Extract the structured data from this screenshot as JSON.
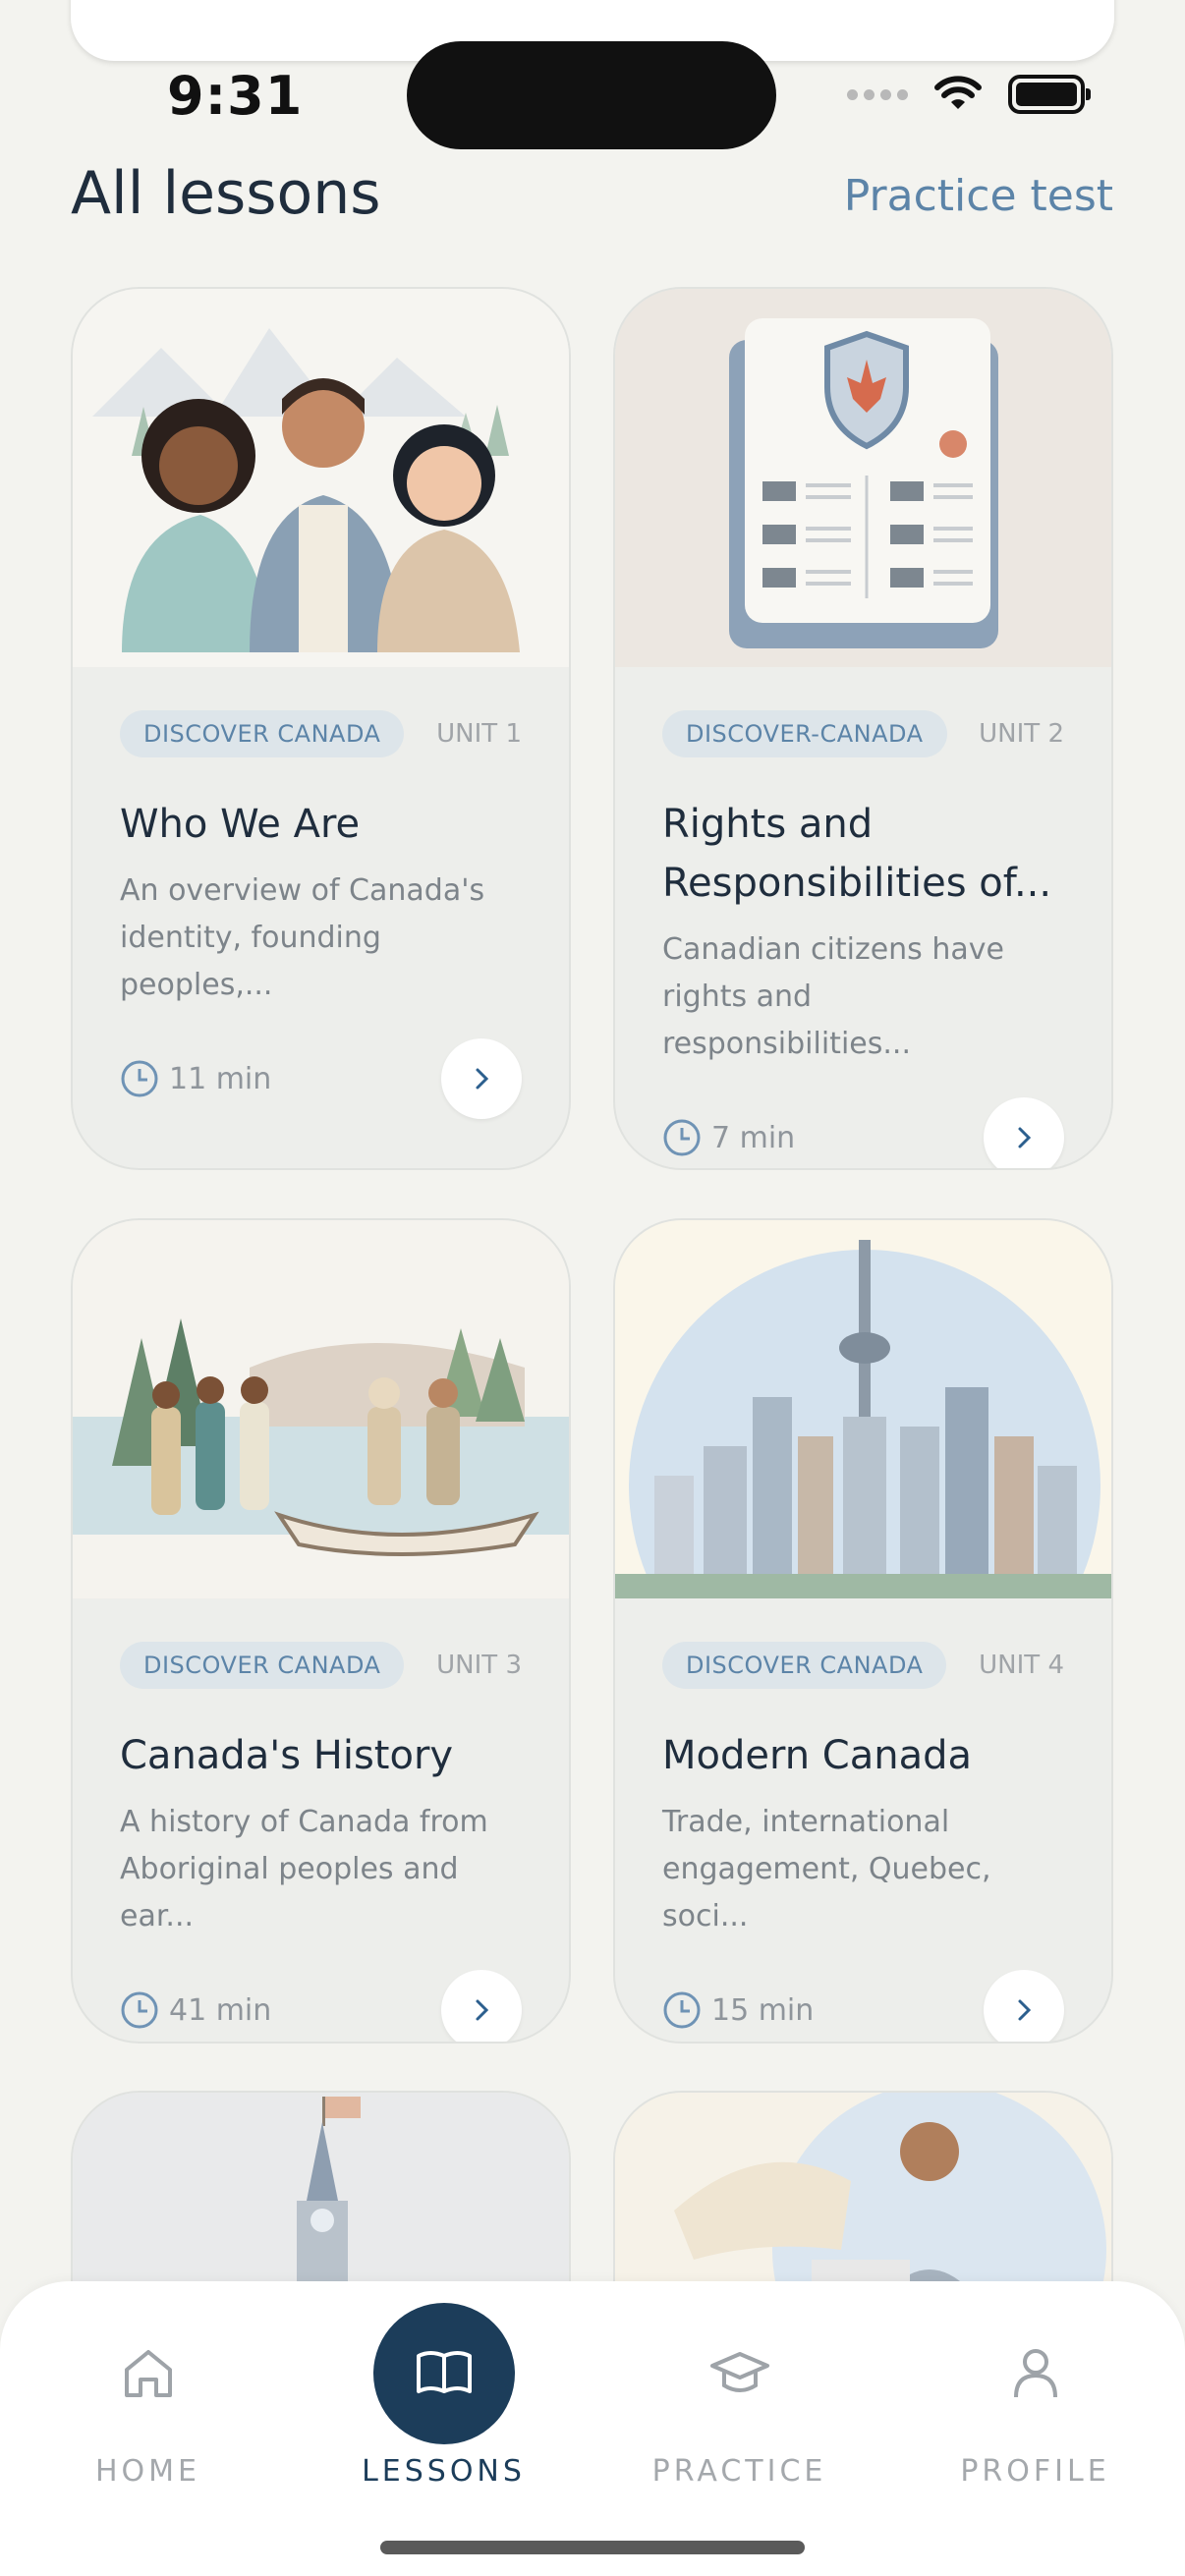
{
  "status_bar": {
    "time": "9:31"
  },
  "header": {
    "title": "All lessons",
    "practice_link": "Practice test"
  },
  "lessons": [
    {
      "tag": "DISCOVER CANADA",
      "unit": "UNIT 1",
      "title": "Who We Are",
      "description_lines": [
        "An overview of Canada's",
        "identity, founding peoples,..."
      ],
      "duration": "11 min",
      "illustration": "three-people-portrait"
    },
    {
      "tag": "DISCOVER-CANADA",
      "unit": "UNIT 2",
      "title_lines": [
        "Rights and",
        "Responsibilities of..."
      ],
      "description_lines": [
        "Canadian citizens have",
        "rights and responsibilities..."
      ],
      "duration": "7 min",
      "illustration": "charter-document-icon"
    },
    {
      "tag": "DISCOVER CANADA",
      "unit": "UNIT 3",
      "title": "Canada's History",
      "description_lines": [
        "A history of Canada from",
        "Aboriginal peoples and ear..."
      ],
      "duration": "41 min",
      "illustration": "history-scene"
    },
    {
      "tag": "DISCOVER CANADA",
      "unit": "UNIT 4",
      "title": "Modern Canada",
      "description_lines": [
        "Trade, international",
        "engagement, Quebec, soci..."
      ],
      "duration": "15 min",
      "illustration": "city-skyline"
    }
  ],
  "nav": [
    {
      "label": "HOME",
      "icon": "home-icon",
      "active": false
    },
    {
      "label": "LESSONS",
      "icon": "book-icon",
      "active": true
    },
    {
      "label": "PRACTICE",
      "icon": "graduation-cap-icon",
      "active": false
    },
    {
      "label": "PROFILE",
      "icon": "person-icon",
      "active": false
    }
  ],
  "colors": {
    "accent": "#5c84a8",
    "nav_active": "#1c3d5a",
    "background": "#f3f3ef",
    "card": "#edeeeb"
  }
}
